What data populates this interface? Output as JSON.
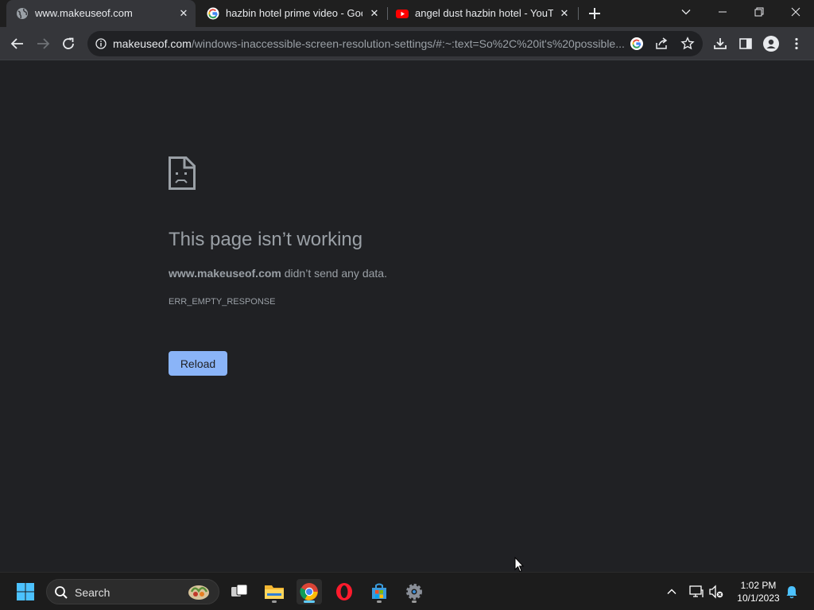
{
  "tabs": [
    {
      "title": "www.makeuseof.com",
      "icon": "globe-icon",
      "active": true
    },
    {
      "title": "hazbin hotel prime video - Goog",
      "icon": "google-icon",
      "active": false
    },
    {
      "title": "angel dust hazbin hotel - YouTub",
      "icon": "youtube-icon",
      "active": false
    }
  ],
  "toolbar": {
    "url_host": "makeuseof.com",
    "url_path": "/windows-inaccessible-screen-resolution-settings/#:~:text=So%2C%20it's%20possible..."
  },
  "error": {
    "title": "This page isn’t working",
    "host": "www.makeuseof.com",
    "message_suffix": " didn’t send any data.",
    "code": "ERR_EMPTY_RESPONSE",
    "reload_label": "Reload"
  },
  "taskbar": {
    "search_label": "Search",
    "time": "1:02 PM",
    "date": "10/1/2023"
  },
  "colors": {
    "accent": "#8ab4f8",
    "background": "#202124",
    "taskbar_active": "#60cdff"
  }
}
